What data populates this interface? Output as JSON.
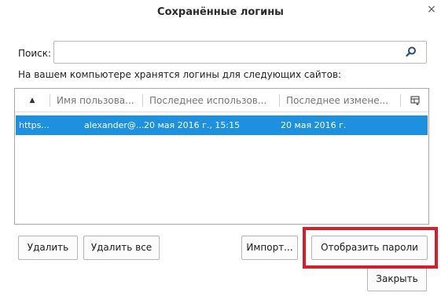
{
  "window": {
    "title": "Сохранённые логины",
    "close_glyph": "×"
  },
  "search": {
    "label": "Поиск:",
    "value": "",
    "placeholder": ""
  },
  "info_text": "На вашем компьютере хранятся логины для следующих сайтов:",
  "table": {
    "sort_indicator": "▲",
    "columns": [
      "Имя пользова...",
      "Последнее использов...",
      "Последнее измене..."
    ],
    "rows": [
      {
        "site": "https...",
        "username": "alexander@...",
        "last_used": "20 мая 2016 г., 15:15",
        "last_changed": "20 мая 2016 г."
      }
    ]
  },
  "buttons": {
    "delete": "Удалить",
    "delete_all": "Удалить все",
    "import": "Импорт...",
    "show_passwords": "Отобразить пароли",
    "close": "Закрыть"
  },
  "colors": {
    "selection": "#1e90e0",
    "highlight_frame": "#d31e2b"
  },
  "icons": {
    "search": "search-icon",
    "column_picker": "column-picker-icon",
    "close": "close-icon"
  }
}
